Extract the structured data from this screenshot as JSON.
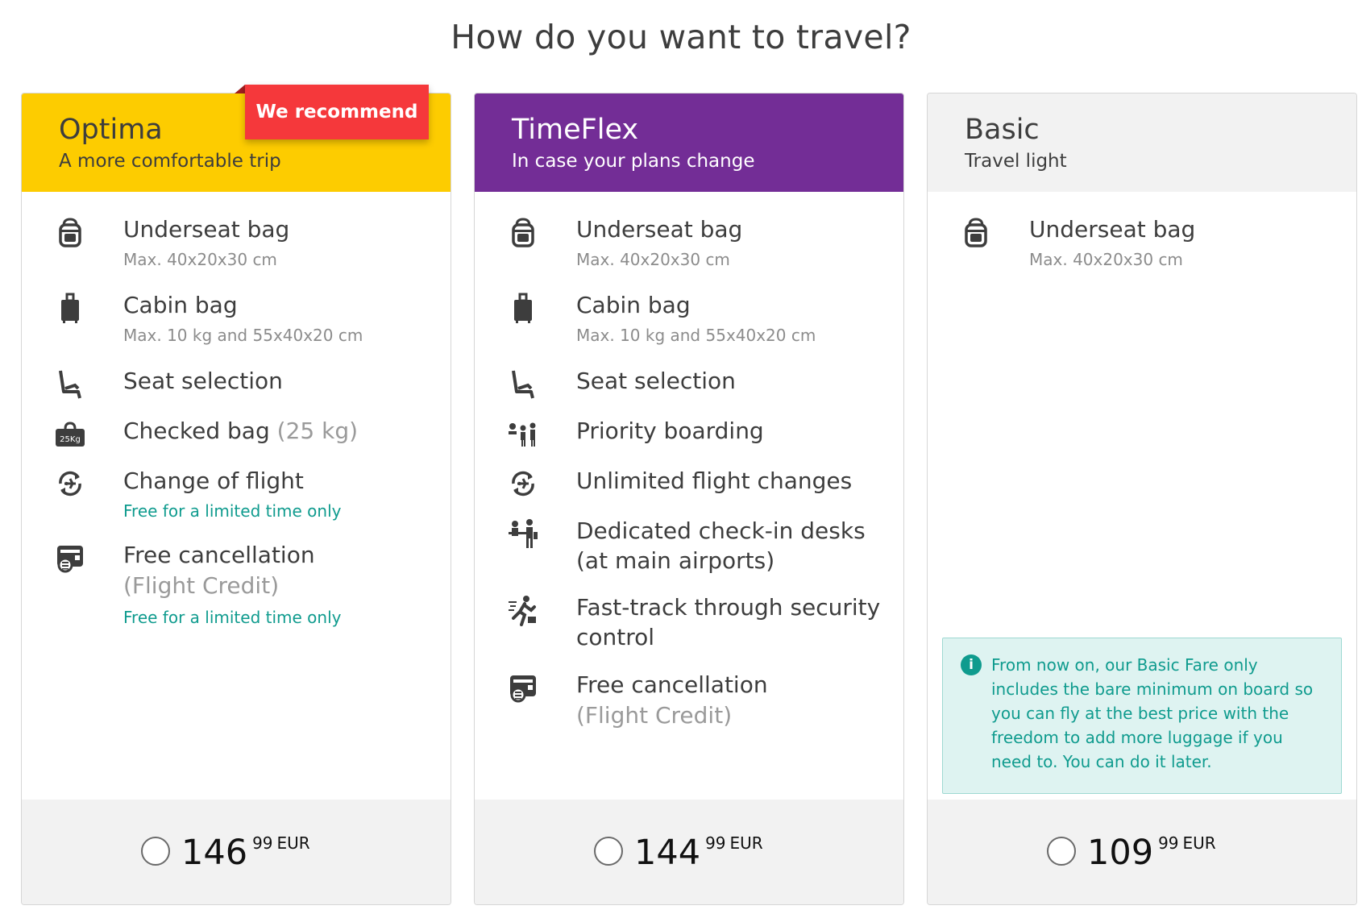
{
  "page": {
    "title": "How do you want to travel?"
  },
  "cards": [
    {
      "name": "Optima",
      "tagline": "A more comfortable trip",
      "badge": "We recommend",
      "features": [
        {
          "title": "Underseat bag",
          "sub": "Max. 40x20x30 cm"
        },
        {
          "title": "Cabin bag",
          "sub": "Max. 10 kg and 55x40x20 cm"
        },
        {
          "title": "Seat selection"
        },
        {
          "title": "Checked bag",
          "title_muted": "(25 kg)",
          "icon_label": "25Kg"
        },
        {
          "title": "Change of flight",
          "promo": "Free for a limited time only"
        },
        {
          "title": "Free cancellation",
          "muted_line": "(Flight Credit)",
          "promo": "Free for a limited time only"
        }
      ],
      "price": {
        "integer": "146",
        "decimal": "99",
        "currency": "EUR"
      }
    },
    {
      "name": "TimeFlex",
      "tagline": "In case your plans change",
      "features": [
        {
          "title": "Underseat bag",
          "sub": "Max. 40x20x30 cm"
        },
        {
          "title": "Cabin bag",
          "sub": "Max. 10 kg and 55x40x20 cm"
        },
        {
          "title": "Seat selection"
        },
        {
          "title": "Priority boarding"
        },
        {
          "title": "Unlimited flight changes"
        },
        {
          "title": "Dedicated check-in desks (at main airports)"
        },
        {
          "title": "Fast-track through security control"
        },
        {
          "title": "Free cancellation",
          "muted_line": "(Flight Credit)"
        }
      ],
      "price": {
        "integer": "144",
        "decimal": "99",
        "currency": "EUR"
      }
    },
    {
      "name": "Basic",
      "tagline": "Travel light",
      "features": [
        {
          "title": "Underseat bag",
          "sub": "Max. 40x20x30 cm"
        }
      ],
      "info": "From now on, our Basic Fare only includes the bare minimum on board so you can fly at the best price with the freedom to add more luggage if you need to. You can do it later.",
      "price": {
        "integer": "109",
        "decimal": "99",
        "currency": "EUR"
      }
    }
  ],
  "colors": {
    "optima": "#fdcc00",
    "timeflex": "#732d96",
    "basic": "#f2f2f2",
    "badge": "#f5383b",
    "promo": "#0f9b8e"
  },
  "icons": [
    "backpack-icon",
    "cabin-bag-icon",
    "seat-icon",
    "checked-bag-icon",
    "flight-change-icon",
    "cancellation-icon",
    "priority-boarding-icon",
    "check-in-desk-icon",
    "fast-track-icon",
    "info-icon"
  ]
}
